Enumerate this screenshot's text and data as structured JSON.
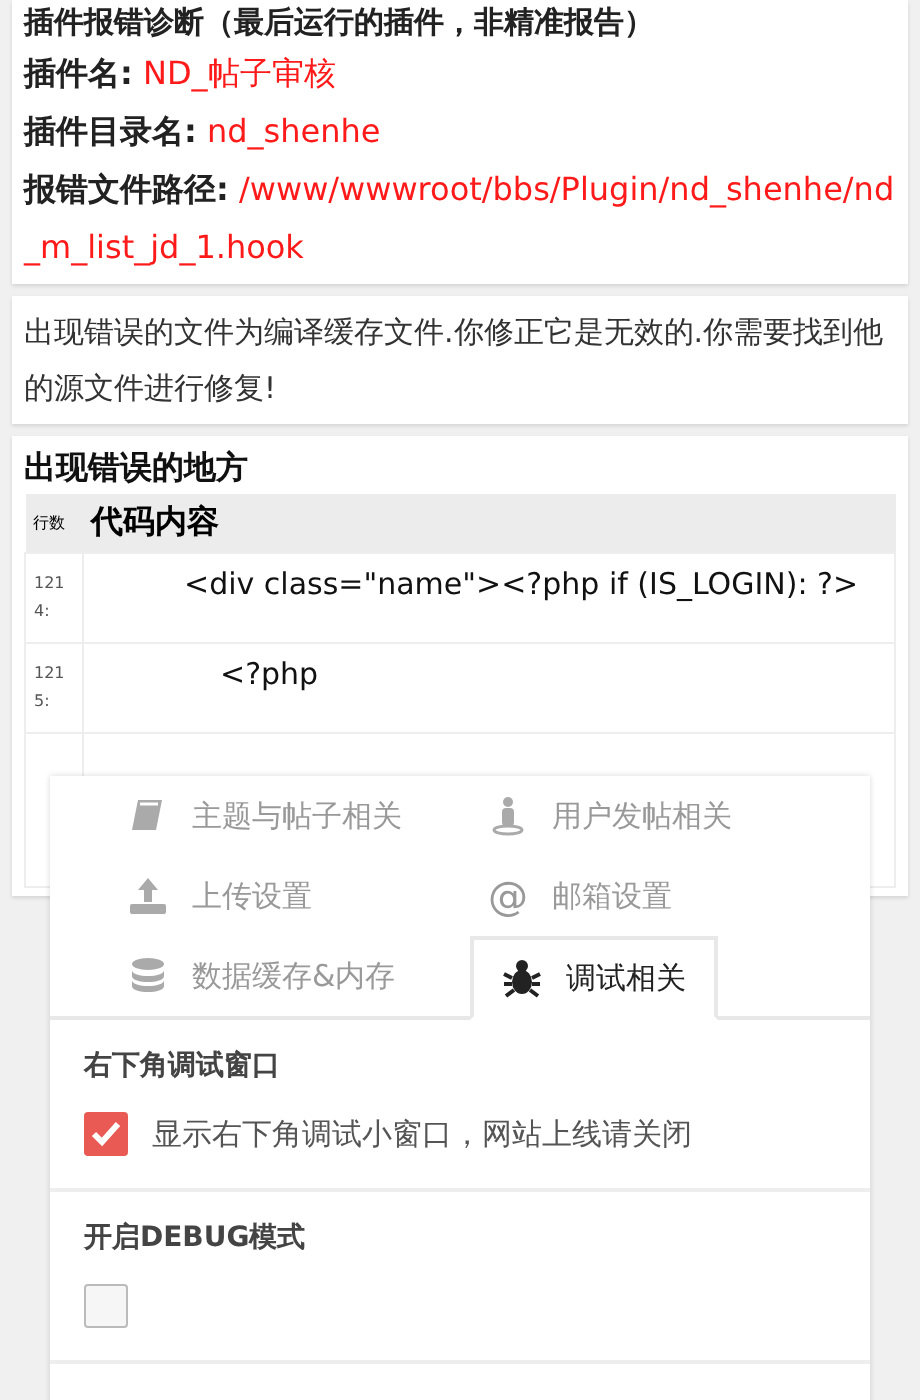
{
  "report": {
    "heading": "插件报错诊断（最后运行的插件，非精准报告）",
    "fields": [
      {
        "label": "插件名:",
        "value": "ND_帖子审核"
      },
      {
        "label": "插件目录名:",
        "value": "nd_shenhe"
      },
      {
        "label": "报错文件路径:",
        "value": "/www/wwwroot/bbs/Plugin/nd_shenhe/nd_m_list_jd_1.hook"
      }
    ]
  },
  "notice": "出现错误的文件为编译缓存文件.你修正它是无效的.你需要找到他的源文件进行修复!",
  "error_location": {
    "title": "出现错误的地方",
    "columns": [
      "行数",
      "代码内容"
    ],
    "rows": [
      {
        "line": "1214:",
        "code": "<div class=\"name\"><?php if (IS_LOGIN): ?>"
      },
      {
        "line": "1215:",
        "code": "<?php"
      }
    ]
  },
  "settings": {
    "tabs": [
      {
        "label": "主题与帖子相关",
        "kind": "book",
        "selected": false
      },
      {
        "label": "用户发帖相关",
        "kind": "person",
        "selected": false
      },
      {
        "label": "上传设置",
        "kind": "upload",
        "selected": false
      },
      {
        "label": "邮箱设置",
        "kind": "glyph",
        "glyph": "@",
        "selected": false
      },
      {
        "label": "数据缓存&内存",
        "kind": "database",
        "selected": false
      },
      {
        "label": "调试相关",
        "kind": "bug",
        "selected": true
      }
    ],
    "sections": [
      {
        "title": "右下角调试窗口",
        "checked": true,
        "label": "显示右下角调试小窗口，网站上线请关闭"
      },
      {
        "title": "开启DEBUG模式",
        "checked": false
      }
    ]
  }
}
